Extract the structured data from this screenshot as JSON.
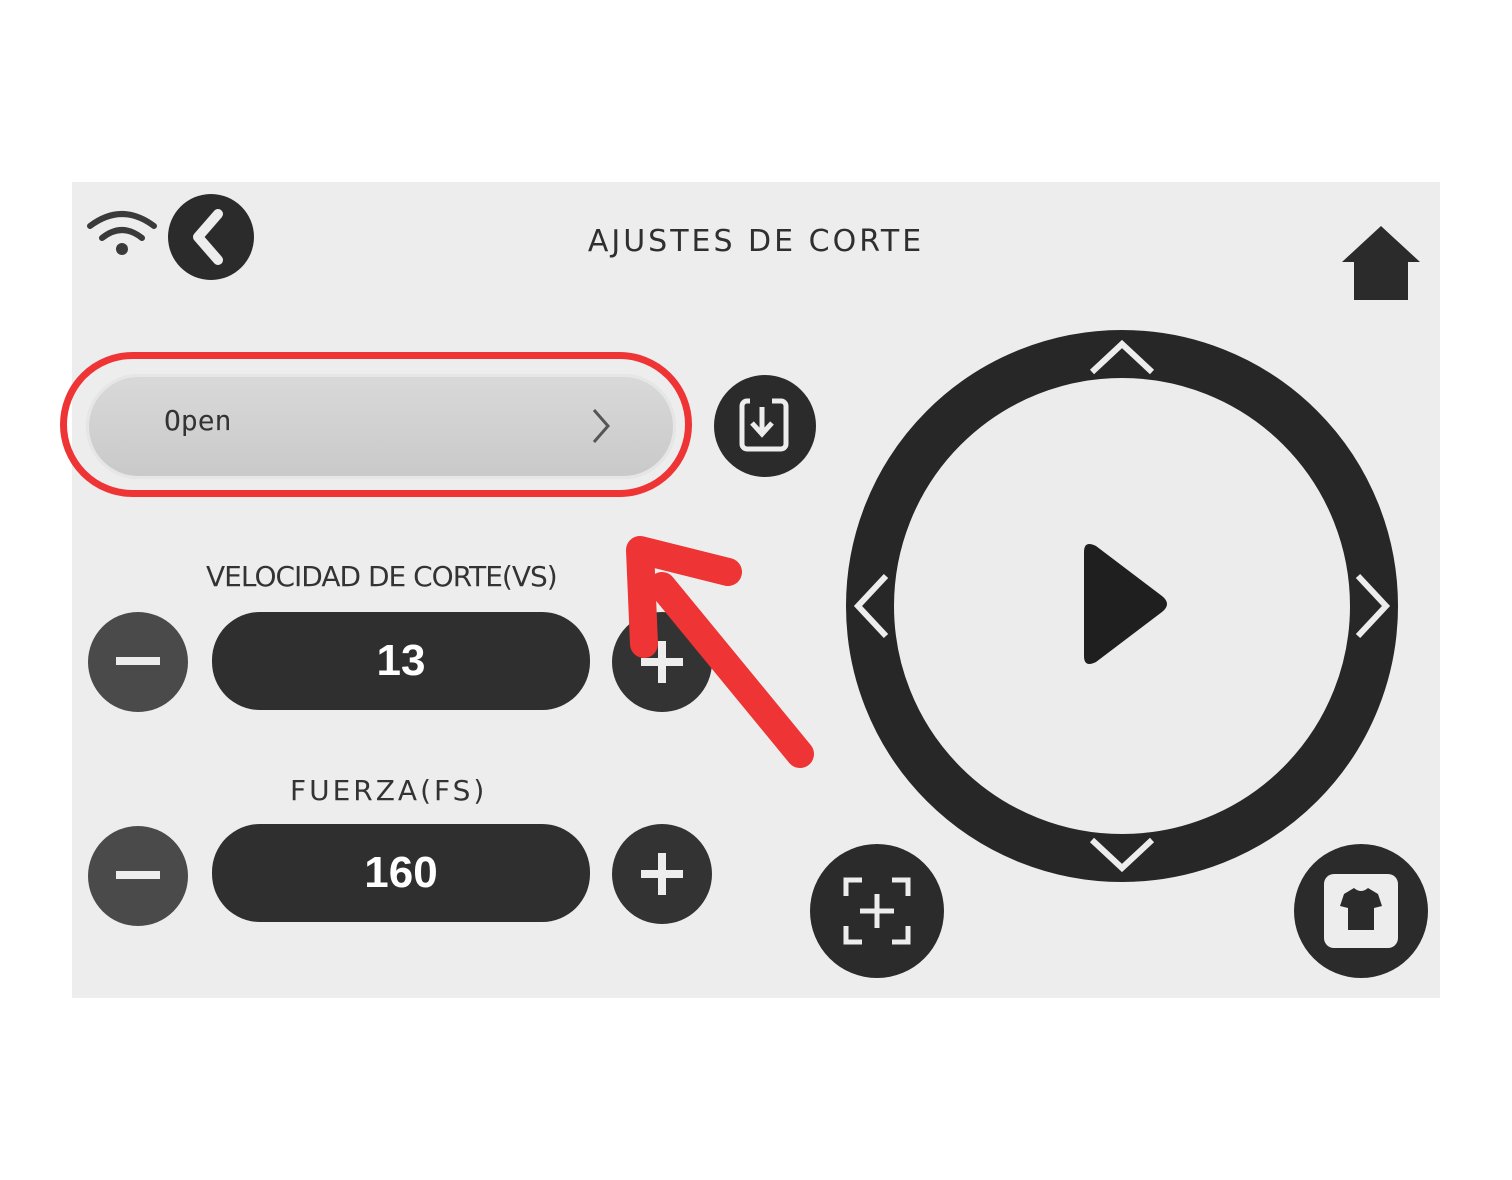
{
  "header": {
    "title": "AJUSTES DE CORTE",
    "wifi_icon": "wifi-icon",
    "back_icon": "back-arrow-icon",
    "home_icon": "home-icon"
  },
  "preset": {
    "value": "Open",
    "chevron_icon": "chevron-right-icon",
    "save_icon": "save-icon"
  },
  "speed": {
    "label": "VELOCIDAD DE CORTE(VS)",
    "value": "13",
    "minus_icon": "minus-icon",
    "plus_icon": "plus-icon"
  },
  "force": {
    "label": "FUERZA(FS)",
    "value": "160",
    "minus_icon": "minus-icon",
    "plus_icon": "plus-icon"
  },
  "jog": {
    "up_icon": "chevron-up-icon",
    "down_icon": "chevron-down-icon",
    "left_icon": "chevron-left-icon",
    "right_icon": "chevron-right-icon",
    "play_icon": "play-icon"
  },
  "bottom_buttons": {
    "focus_icon": "crosshair-icon",
    "material_icon": "tshirt-icon"
  },
  "annotation": {
    "color": "#ee3434"
  }
}
